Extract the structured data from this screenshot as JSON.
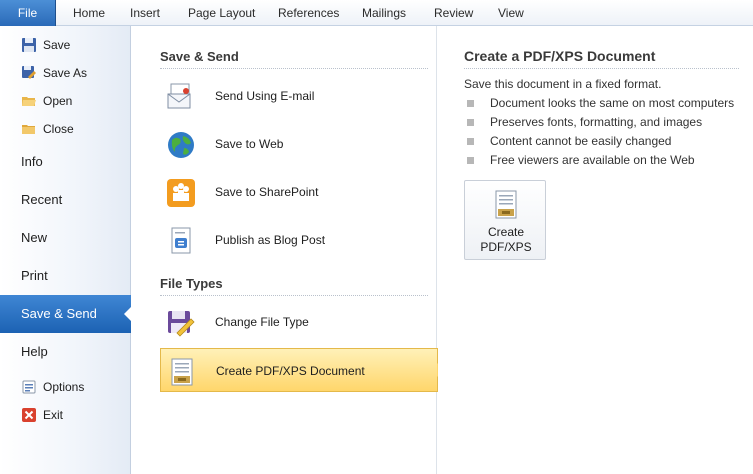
{
  "ribbon": {
    "tabs": [
      {
        "label": "File"
      },
      {
        "label": "Home"
      },
      {
        "label": "Insert"
      },
      {
        "label": "Page Layout"
      },
      {
        "label": "References"
      },
      {
        "label": "Mailings"
      },
      {
        "label": "Review"
      },
      {
        "label": "View"
      }
    ]
  },
  "nav": {
    "commands_top": [
      {
        "label": "Save",
        "icon": "save-icon"
      },
      {
        "label": "Save As",
        "icon": "save-as-icon"
      },
      {
        "label": "Open",
        "icon": "open-folder-icon"
      },
      {
        "label": "Close",
        "icon": "close-folder-icon"
      }
    ],
    "items": [
      {
        "label": "Info"
      },
      {
        "label": "Recent"
      },
      {
        "label": "New"
      },
      {
        "label": "Print"
      },
      {
        "label": "Save & Send",
        "selected": true
      },
      {
        "label": "Help"
      }
    ],
    "commands_bottom": [
      {
        "label": "Options",
        "icon": "options-icon"
      },
      {
        "label": "Exit",
        "icon": "exit-icon"
      }
    ]
  },
  "middle": {
    "save_send_heading": "Save & Send",
    "save_send_options": [
      {
        "label": "Send Using E-mail",
        "icon": "email-icon"
      },
      {
        "label": "Save to Web",
        "icon": "globe-icon"
      },
      {
        "label": "Save to SharePoint",
        "icon": "sharepoint-icon"
      },
      {
        "label": "Publish as Blog Post",
        "icon": "blog-post-icon"
      }
    ],
    "file_types_heading": "File Types",
    "file_types_options": [
      {
        "label": "Change File Type",
        "icon": "change-file-type-icon"
      },
      {
        "label": "Create PDF/XPS Document",
        "icon": "pdf-xps-icon",
        "selected": true
      }
    ]
  },
  "right": {
    "title": "Create a PDF/XPS Document",
    "description": "Save this document in a fixed format.",
    "bullets": [
      "Document looks the same on most computers",
      "Preserves fonts, formatting, and images",
      "Content cannot be easily changed",
      "Free viewers are available on the Web"
    ],
    "button_label": "Create\nPDF/XPS",
    "button_icon": "pdf-xps-icon"
  },
  "colors": {
    "file_tab": "#2a6ab8",
    "nav_selected": "#1c62b3",
    "option_selected": "#ffd66b"
  }
}
